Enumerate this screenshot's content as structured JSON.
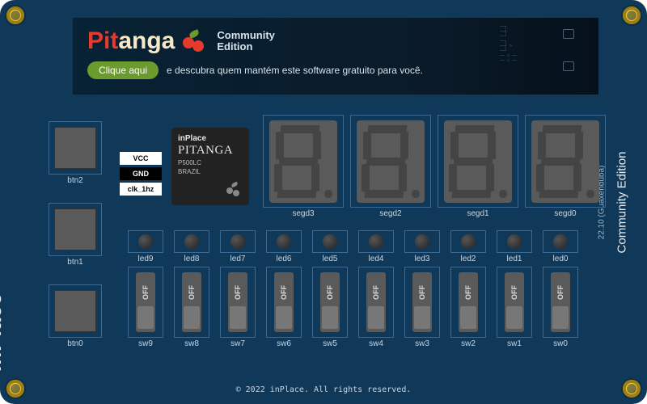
{
  "banner": {
    "title_pit": "Pit",
    "title_anga": "anga",
    "edition_line1": "Community",
    "edition_line2": "Edition",
    "cta": "Clique aqui",
    "tagline": "e descubra quem mantém este software gratuito para você."
  },
  "brand": "inPlace",
  "version": {
    "edition": "Community Edition",
    "number": "22.10 (Guaxenduba)"
  },
  "buttons": [
    {
      "label": "btn2"
    },
    {
      "label": "btn1"
    },
    {
      "label": "btn0"
    }
  ],
  "pins": [
    {
      "label": "VCC",
      "style": "w"
    },
    {
      "label": "GND",
      "style": "b"
    },
    {
      "label": "clk_1hz",
      "style": "w"
    }
  ],
  "chip": {
    "brand": "inPlace",
    "name": "PITANGA",
    "model": "P500LC",
    "country": "BRAZIL"
  },
  "segments": [
    {
      "label": "segd3"
    },
    {
      "label": "segd2"
    },
    {
      "label": "segd1"
    },
    {
      "label": "segd0"
    }
  ],
  "leds": [
    {
      "label": "led9"
    },
    {
      "label": "led8"
    },
    {
      "label": "led7"
    },
    {
      "label": "led6"
    },
    {
      "label": "led5"
    },
    {
      "label": "led4"
    },
    {
      "label": "led3"
    },
    {
      "label": "led2"
    },
    {
      "label": "led1"
    },
    {
      "label": "led0"
    }
  ],
  "switches": [
    {
      "label": "sw9",
      "state": "OFF"
    },
    {
      "label": "sw8",
      "state": "OFF"
    },
    {
      "label": "sw7",
      "state": "OFF"
    },
    {
      "label": "sw6",
      "state": "OFF"
    },
    {
      "label": "sw5",
      "state": "OFF"
    },
    {
      "label": "sw4",
      "state": "OFF"
    },
    {
      "label": "sw3",
      "state": "OFF"
    },
    {
      "label": "sw2",
      "state": "OFF"
    },
    {
      "label": "sw1",
      "state": "OFF"
    },
    {
      "label": "sw0",
      "state": "OFF"
    }
  ],
  "footer": "© 2022 inPlace. All rights reserved."
}
